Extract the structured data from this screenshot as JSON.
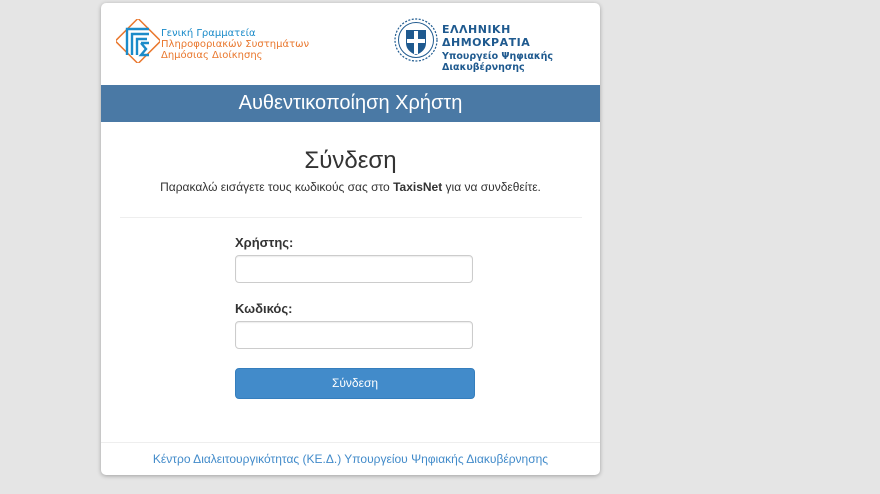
{
  "header": {
    "gsis": {
      "line1": "Γενική Γραμματεία",
      "line2": "Πληροφοριακών Συστημάτων",
      "line3": "Δημόσιας Διοίκησης"
    },
    "republic": {
      "title": "ΕΛΛΗΝΙΚΗ ΔΗΜΟΚΡΑΤΙΑ",
      "line1": "Υπουργείο Ψηφιακής",
      "line2": "Διακυβέρνησης"
    }
  },
  "banner": {
    "title": "Αυθεντικοποίηση Χρήστη"
  },
  "login": {
    "title": "Σύνδεση",
    "subtitle_pre": "Παρακαλώ εισάγετε τους κωδικούς σας στο ",
    "subtitle_bold": "TaxisNet",
    "subtitle_post": " για να συνδεθείτε.",
    "username_label": "Χρήστης:",
    "username_value": "",
    "password_label": "Κωδικός:",
    "password_value": "",
    "submit_label": "Σύνδεση"
  },
  "footer": {
    "link": "Κέντρο Διαλειτουργικότητας (ΚΕ.Δ.) Υπουργείου Ψηφιακής Διακυβέρνησης"
  },
  "colors": {
    "banner": "#4a79a5",
    "button": "#428bca",
    "link": "#428bca",
    "gsis_blue": "#1b8bc9",
    "gsis_orange": "#e9772d",
    "republic_blue": "#1f5a8f"
  }
}
